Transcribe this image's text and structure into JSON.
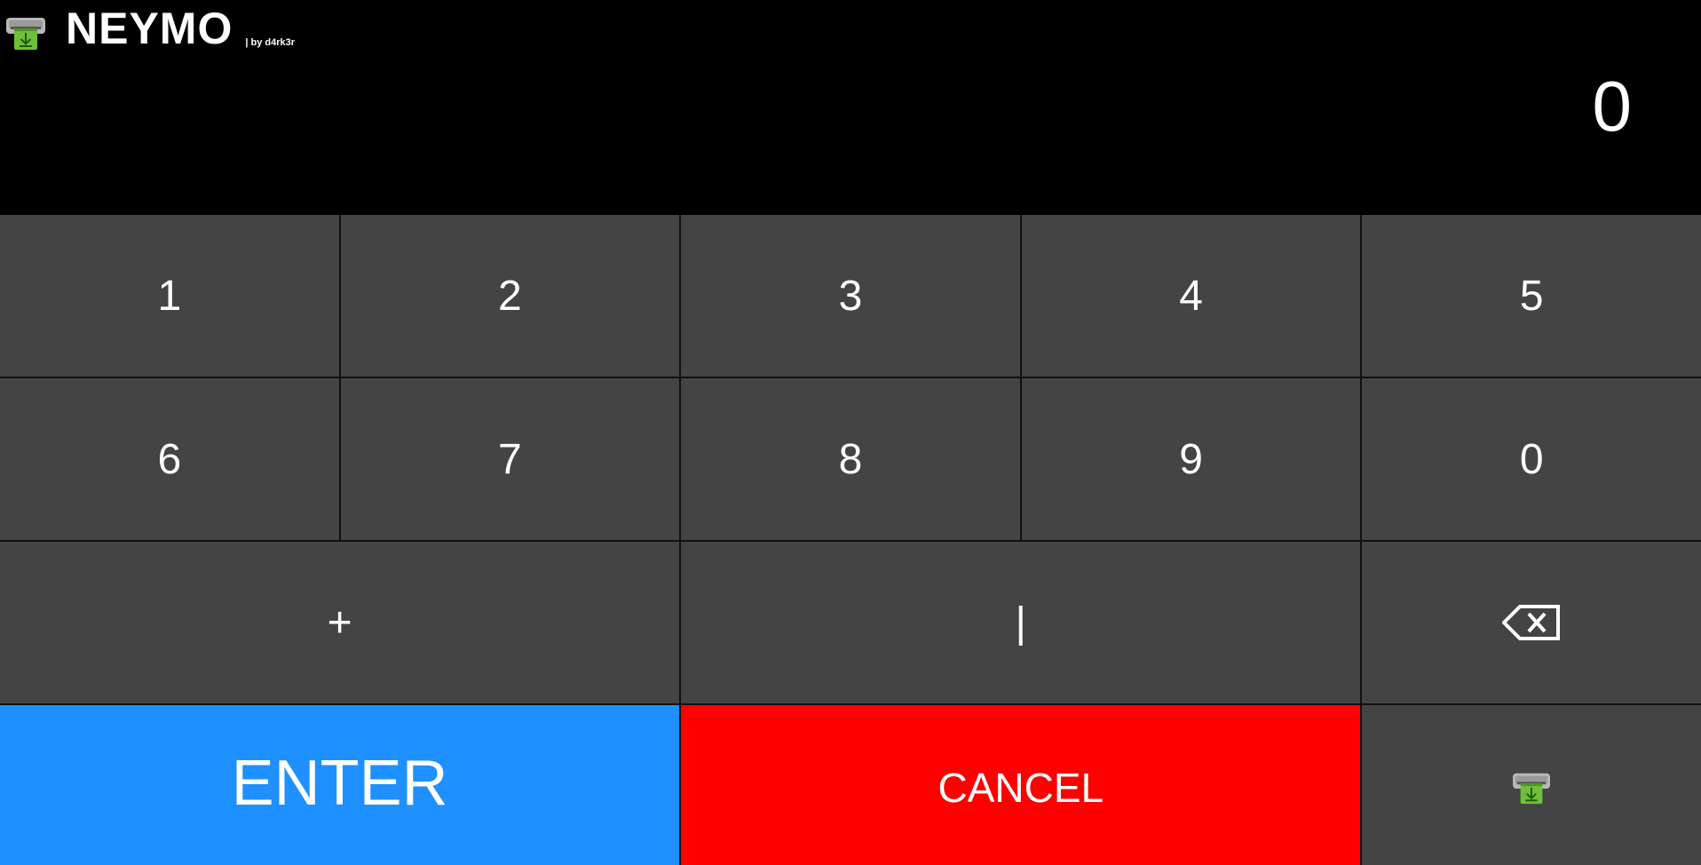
{
  "header": {
    "title": "NEYMO",
    "byline": "| by d4rk3r",
    "logo_icon": "atm-download-icon"
  },
  "display": {
    "value": "0"
  },
  "keypad": {
    "row1": [
      "1",
      "2",
      "3",
      "4",
      "5"
    ],
    "row2": [
      "6",
      "7",
      "8",
      "9",
      "0"
    ],
    "plus_label": "+",
    "separator_label": "|",
    "backspace_icon": "backspace-icon",
    "enter_label": "ENTER",
    "cancel_label": "CANCEL",
    "atm_icon": "atm-download-icon"
  },
  "colors": {
    "background": "#000000",
    "key": "#444444",
    "enter": "#1e90ff",
    "cancel": "#ff0000",
    "logo_green": "#6fbf3a"
  }
}
